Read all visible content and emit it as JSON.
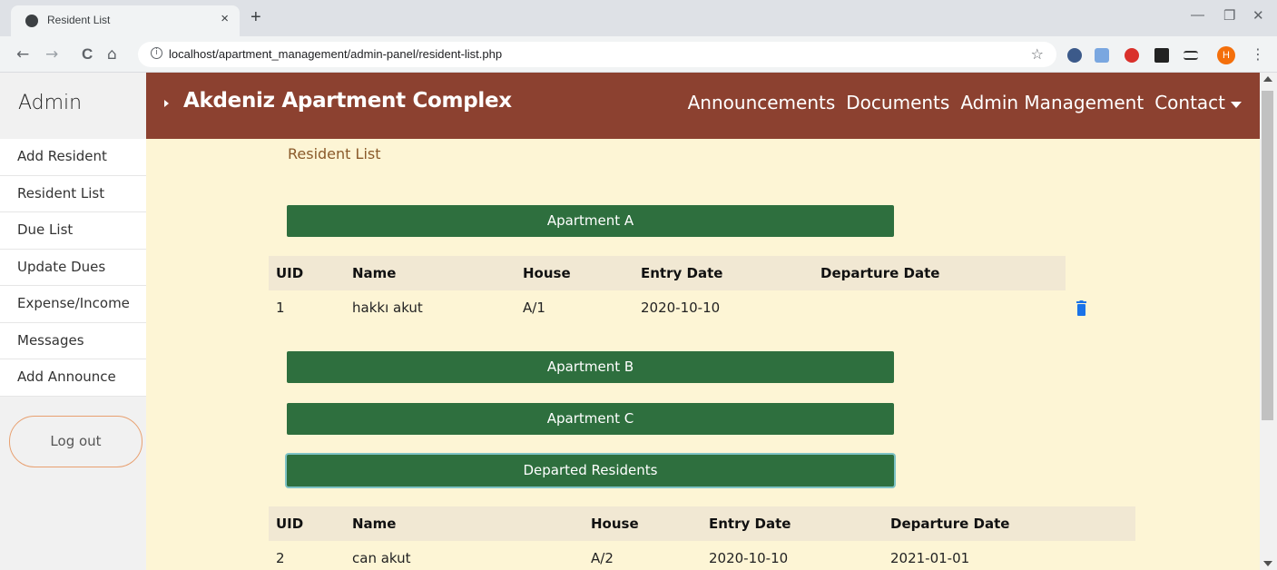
{
  "browser": {
    "tab_title": "Resident List",
    "tab_close": "×",
    "new_tab": "+",
    "url": "localhost/apartment_management/admin-panel/resident-list.php",
    "avatar_letter": "H",
    "win_min": "—",
    "win_restore": "❐",
    "win_close": "✕",
    "back": "←",
    "forward": "→",
    "reload": "C",
    "home": "⌂",
    "star": "☆",
    "kebab": "⋮",
    "extensions": [
      "translate-icon",
      "google-translate-icon",
      "adblock-icon",
      "puzzle-icon",
      "reading-list-icon"
    ]
  },
  "sidebar": {
    "title": "Admin",
    "items": [
      {
        "label": "Add Resident"
      },
      {
        "label": "Resident List"
      },
      {
        "label": "Due List"
      },
      {
        "label": "Update Dues"
      },
      {
        "label": "Expense/Income"
      },
      {
        "label": "Messages"
      },
      {
        "label": "Add Announce"
      }
    ],
    "logout_label": "Log out"
  },
  "topnav": {
    "brand": "Akdeniz Apartment Complex",
    "links": [
      "Announcements",
      "Documents",
      "Admin Management",
      "Contact"
    ]
  },
  "main": {
    "heading": "Resident List",
    "sections": [
      "Apartment A",
      "Apartment B",
      "Apartment C",
      "Departed Residents"
    ],
    "table_a": {
      "headers": [
        "UID",
        "Name",
        "House",
        "Entry Date",
        "Departure Date"
      ],
      "rows": [
        {
          "uid": "1",
          "name": "hakkı akut",
          "house": "A/1",
          "entry": "2020-10-10",
          "departure": ""
        }
      ]
    },
    "table_departed": {
      "headers": [
        "UID",
        "Name",
        "House",
        "Entry Date",
        "Departure Date"
      ],
      "rows": [
        {
          "uid": "2",
          "name": "can akut",
          "house": "A/2",
          "entry": "2020-10-10",
          "departure": "2021-01-01"
        }
      ]
    }
  },
  "colors": {
    "nav_bg": "#8c4130",
    "page_bg": "#fdf5d5",
    "section_btn": "#2e6f3e",
    "trash": "#1a73e8"
  }
}
